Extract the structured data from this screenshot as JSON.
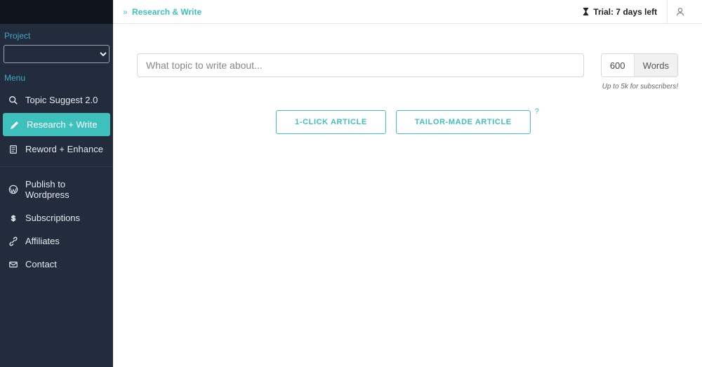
{
  "sidebar": {
    "projectLabel": "Project",
    "menuLabel": "Menu",
    "items": [
      {
        "label": "Topic Suggest 2.0",
        "icon": "search-icon",
        "active": false
      },
      {
        "label": "Research + Write",
        "icon": "pencil-icon",
        "active": true
      },
      {
        "label": "Reword + Enhance",
        "icon": "document-icon",
        "active": false
      }
    ],
    "items2": [
      {
        "label": "Publish to Wordpress",
        "icon": "wordpress-icon"
      },
      {
        "label": "Subscriptions",
        "icon": "dollar-icon"
      },
      {
        "label": "Affiliates",
        "icon": "link-icon"
      },
      {
        "label": "Contact",
        "icon": "mail-icon"
      }
    ]
  },
  "topbar": {
    "breadcrumb": "Research & Write",
    "trial": "Trial: 7 days left"
  },
  "main": {
    "topicPlaceholder": "What topic to write about...",
    "wordsValue": "600",
    "wordsLabel": "Words",
    "subscriberNote": "Up to 5k for subscribers!",
    "oneClickLabel": "1-CLICK ARTICLE",
    "tailorLabel": "TAILOR-MADE ARTICLE",
    "helpChar": "?"
  }
}
